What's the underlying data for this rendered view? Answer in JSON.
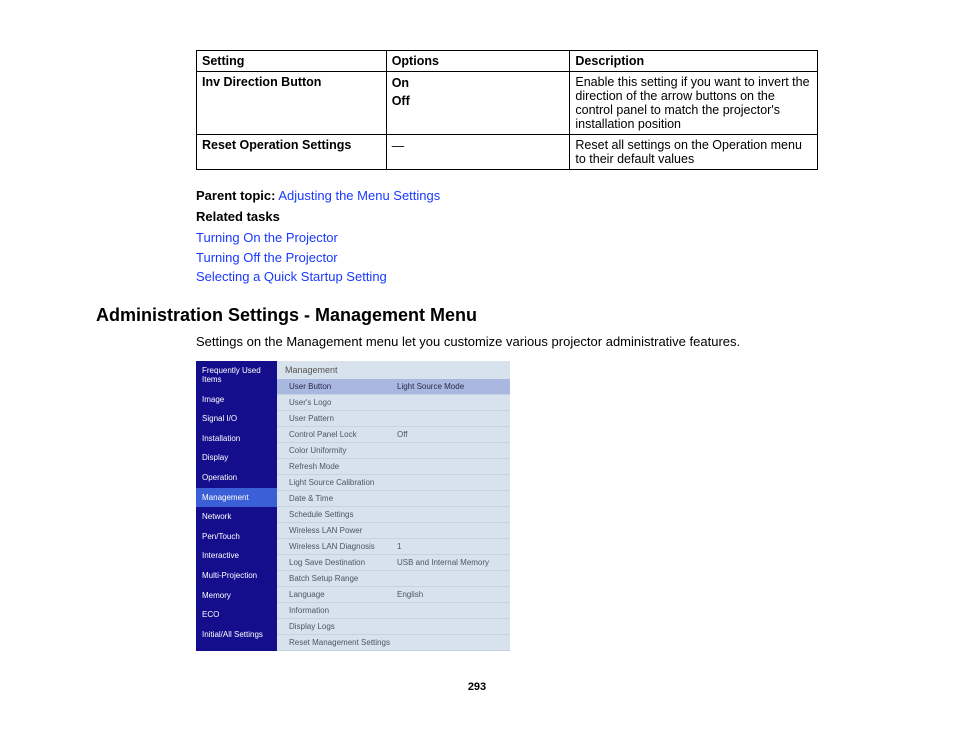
{
  "table": {
    "headers": [
      "Setting",
      "Options",
      "Description"
    ],
    "rows": [
      {
        "setting": "Inv Direction Button",
        "options": [
          "On",
          "Off"
        ],
        "description": "Enable this setting if you want to invert the direction of the arrow buttons on the control panel to match the projector's installation position"
      },
      {
        "setting": "Reset Operation Settings",
        "options": [
          "—"
        ],
        "description": "Reset all settings on the Operation menu to their default values"
      }
    ]
  },
  "parent_topic": {
    "label": "Parent topic:",
    "link": "Adjusting the Menu Settings"
  },
  "related": {
    "label": "Related tasks",
    "links": [
      "Turning On the Projector",
      "Turning Off the Projector",
      "Selecting a Quick Startup Setting"
    ]
  },
  "section_heading": "Administration Settings - Management Menu",
  "section_intro": "Settings on the Management menu let you customize various projector administrative features.",
  "proj_menu": {
    "header": "Management",
    "sidebar": [
      {
        "label": "Frequently Used Items",
        "selected": false
      },
      {
        "label": "Image",
        "selected": false
      },
      {
        "label": "Signal I/O",
        "selected": false
      },
      {
        "label": "Installation",
        "selected": false
      },
      {
        "label": "Display",
        "selected": false
      },
      {
        "label": "Operation",
        "selected": false
      },
      {
        "label": "Management",
        "selected": true
      },
      {
        "label": "Network",
        "selected": false
      },
      {
        "label": "Pen/Touch",
        "selected": false
      },
      {
        "label": "Interactive",
        "selected": false
      },
      {
        "label": "Multi-Projection",
        "selected": false
      },
      {
        "label": "Memory",
        "selected": false
      },
      {
        "label": "ECO",
        "selected": false
      },
      {
        "label": "Initial/All Settings",
        "selected": false
      }
    ],
    "items": [
      {
        "label": "User Button",
        "value": "Light Source Mode",
        "highlight": true
      },
      {
        "label": "User's Logo",
        "value": ""
      },
      {
        "label": "User Pattern",
        "value": ""
      },
      {
        "label": "Control Panel Lock",
        "value": "Off"
      },
      {
        "label": "Color Uniformity",
        "value": ""
      },
      {
        "label": "Refresh Mode",
        "value": ""
      },
      {
        "label": "Light Source Calibration",
        "value": ""
      },
      {
        "label": "Date & Time",
        "value": ""
      },
      {
        "label": "Schedule Settings",
        "value": ""
      },
      {
        "label": "Wireless LAN Power",
        "value": ""
      },
      {
        "label": "Wireless LAN Diagnosis",
        "value": "1"
      },
      {
        "label": "Log Save Destination",
        "value": "USB and Internal Memory"
      },
      {
        "label": "Batch Setup Range",
        "value": ""
      },
      {
        "label": "Language",
        "value": "English"
      },
      {
        "label": "Information",
        "value": ""
      },
      {
        "label": "Display Logs",
        "value": ""
      },
      {
        "label": "Reset Management Settings",
        "value": ""
      }
    ]
  },
  "page_number": "293"
}
